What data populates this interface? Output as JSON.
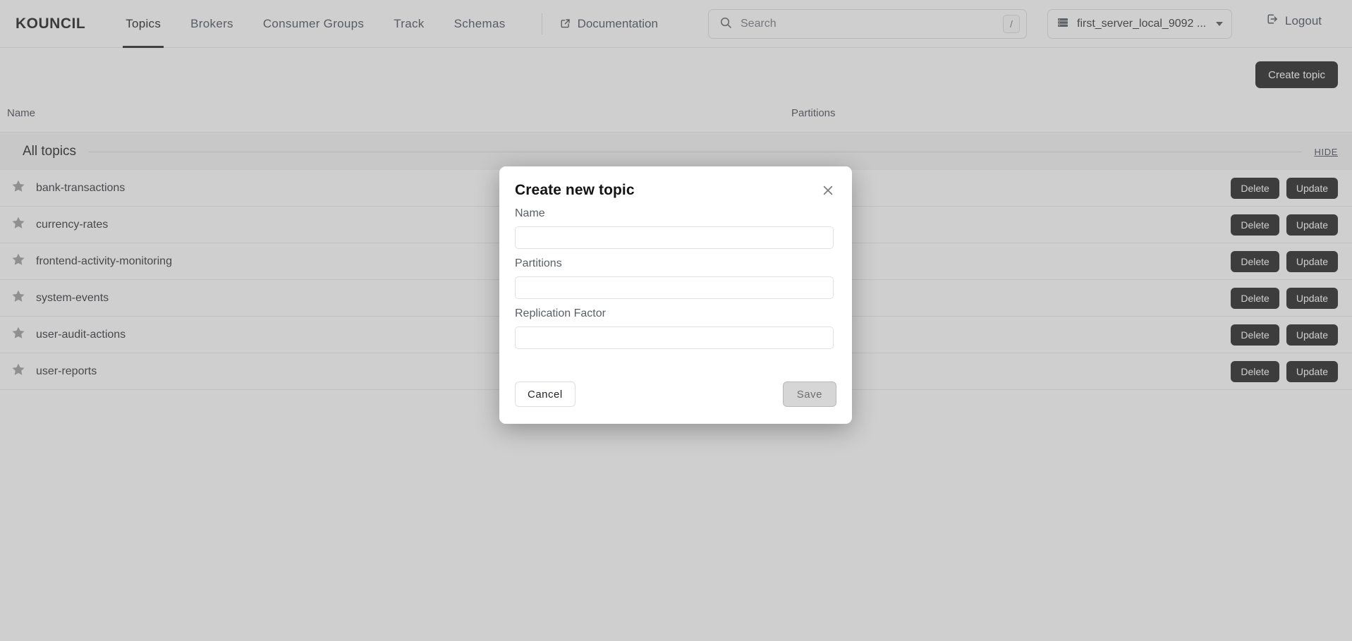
{
  "header": {
    "brand": "KOUNCIL",
    "nav": [
      {
        "label": "Topics",
        "active": true
      },
      {
        "label": "Brokers",
        "active": false
      },
      {
        "label": "Consumer Groups",
        "active": false
      },
      {
        "label": "Track",
        "active": false
      },
      {
        "label": "Schemas",
        "active": false
      }
    ],
    "documentation_label": "Documentation",
    "documentation_icon": "external-link-icon",
    "search": {
      "placeholder": "Search",
      "value": "",
      "icon": "search-icon",
      "shortcut_key": "/"
    },
    "server_selector": {
      "icon": "server-icon",
      "label": "first_server_local_9092 ...",
      "caret_icon": "chevron-down-icon"
    },
    "logout": {
      "label": "Logout",
      "icon": "logout-icon"
    }
  },
  "toolbar": {
    "create_topic_label": "Create topic"
  },
  "table": {
    "columns": [
      "Name",
      "Partitions"
    ],
    "section": {
      "title": "All topics",
      "hide_label": "HIDE"
    },
    "row_actions": {
      "delete_label": "Delete",
      "update_label": "Update"
    },
    "rows": [
      {
        "name": "bank-transactions",
        "partitions": "",
        "star_icon": "star-icon"
      },
      {
        "name": "currency-rates",
        "partitions": "",
        "star_icon": "star-icon"
      },
      {
        "name": "frontend-activity-monitoring",
        "partitions": "",
        "star_icon": "star-icon"
      },
      {
        "name": "system-events",
        "partitions": "",
        "star_icon": "star-icon"
      },
      {
        "name": "user-audit-actions",
        "partitions": "",
        "star_icon": "star-icon"
      },
      {
        "name": "user-reports",
        "partitions": "",
        "star_icon": "star-icon"
      }
    ]
  },
  "modal": {
    "title": "Create new topic",
    "close_icon": "close-icon",
    "fields": [
      {
        "label": "Name",
        "value": "",
        "placeholder": ""
      },
      {
        "label": "Partitions",
        "value": "",
        "placeholder": ""
      },
      {
        "label": "Replication Factor",
        "value": "",
        "placeholder": ""
      }
    ],
    "cancel_label": "Cancel",
    "save_label": "Save",
    "save_disabled": true
  },
  "colors": {
    "accent_dark": "#141414",
    "page_background": "#ffffff",
    "section_background": "#f4f4f4",
    "backdrop": "rgba(128,128,128,0.38)",
    "muted_text": "#5a5f66"
  }
}
